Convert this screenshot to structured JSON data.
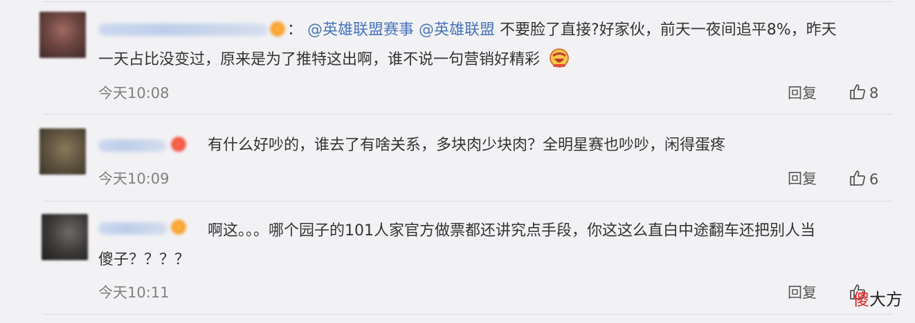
{
  "comments": [
    {
      "colon": "：",
      "mentions": [
        "@英雄联盟赛事",
        "@英雄联盟"
      ],
      "line1_text": " 不要脸了直接?好家伙，前天一夜间追平8%，昨天",
      "line2_text": "一天占比没变过，原来是为了推特这出啊，谁不说一句营销好精彩",
      "emoji": "laughing-emoji-icon",
      "time": "今天10:08",
      "reply_label": "回复",
      "likes": "8"
    },
    {
      "line1_text": "有什么好吵的，谁去了有啥关系，多块肉少块肉？全明星赛也吵吵，闲得蛋疼",
      "time": "今天10:09",
      "reply_label": "回复",
      "likes": "6"
    },
    {
      "line1_text": "啊这。。。哪个园子的101人家官方做票都还讲究点手段，你这这么直白中途翻车还把别人当",
      "line2_text": "傻子？？？？",
      "time": "今天10:11",
      "reply_label": "回复"
    }
  ],
  "watermark": {
    "red": "傻",
    "rest": "大方"
  },
  "colors": {
    "mention": "#4a74b8",
    "time": "#808080",
    "text": "#333333",
    "background": "#f2f2f5"
  }
}
